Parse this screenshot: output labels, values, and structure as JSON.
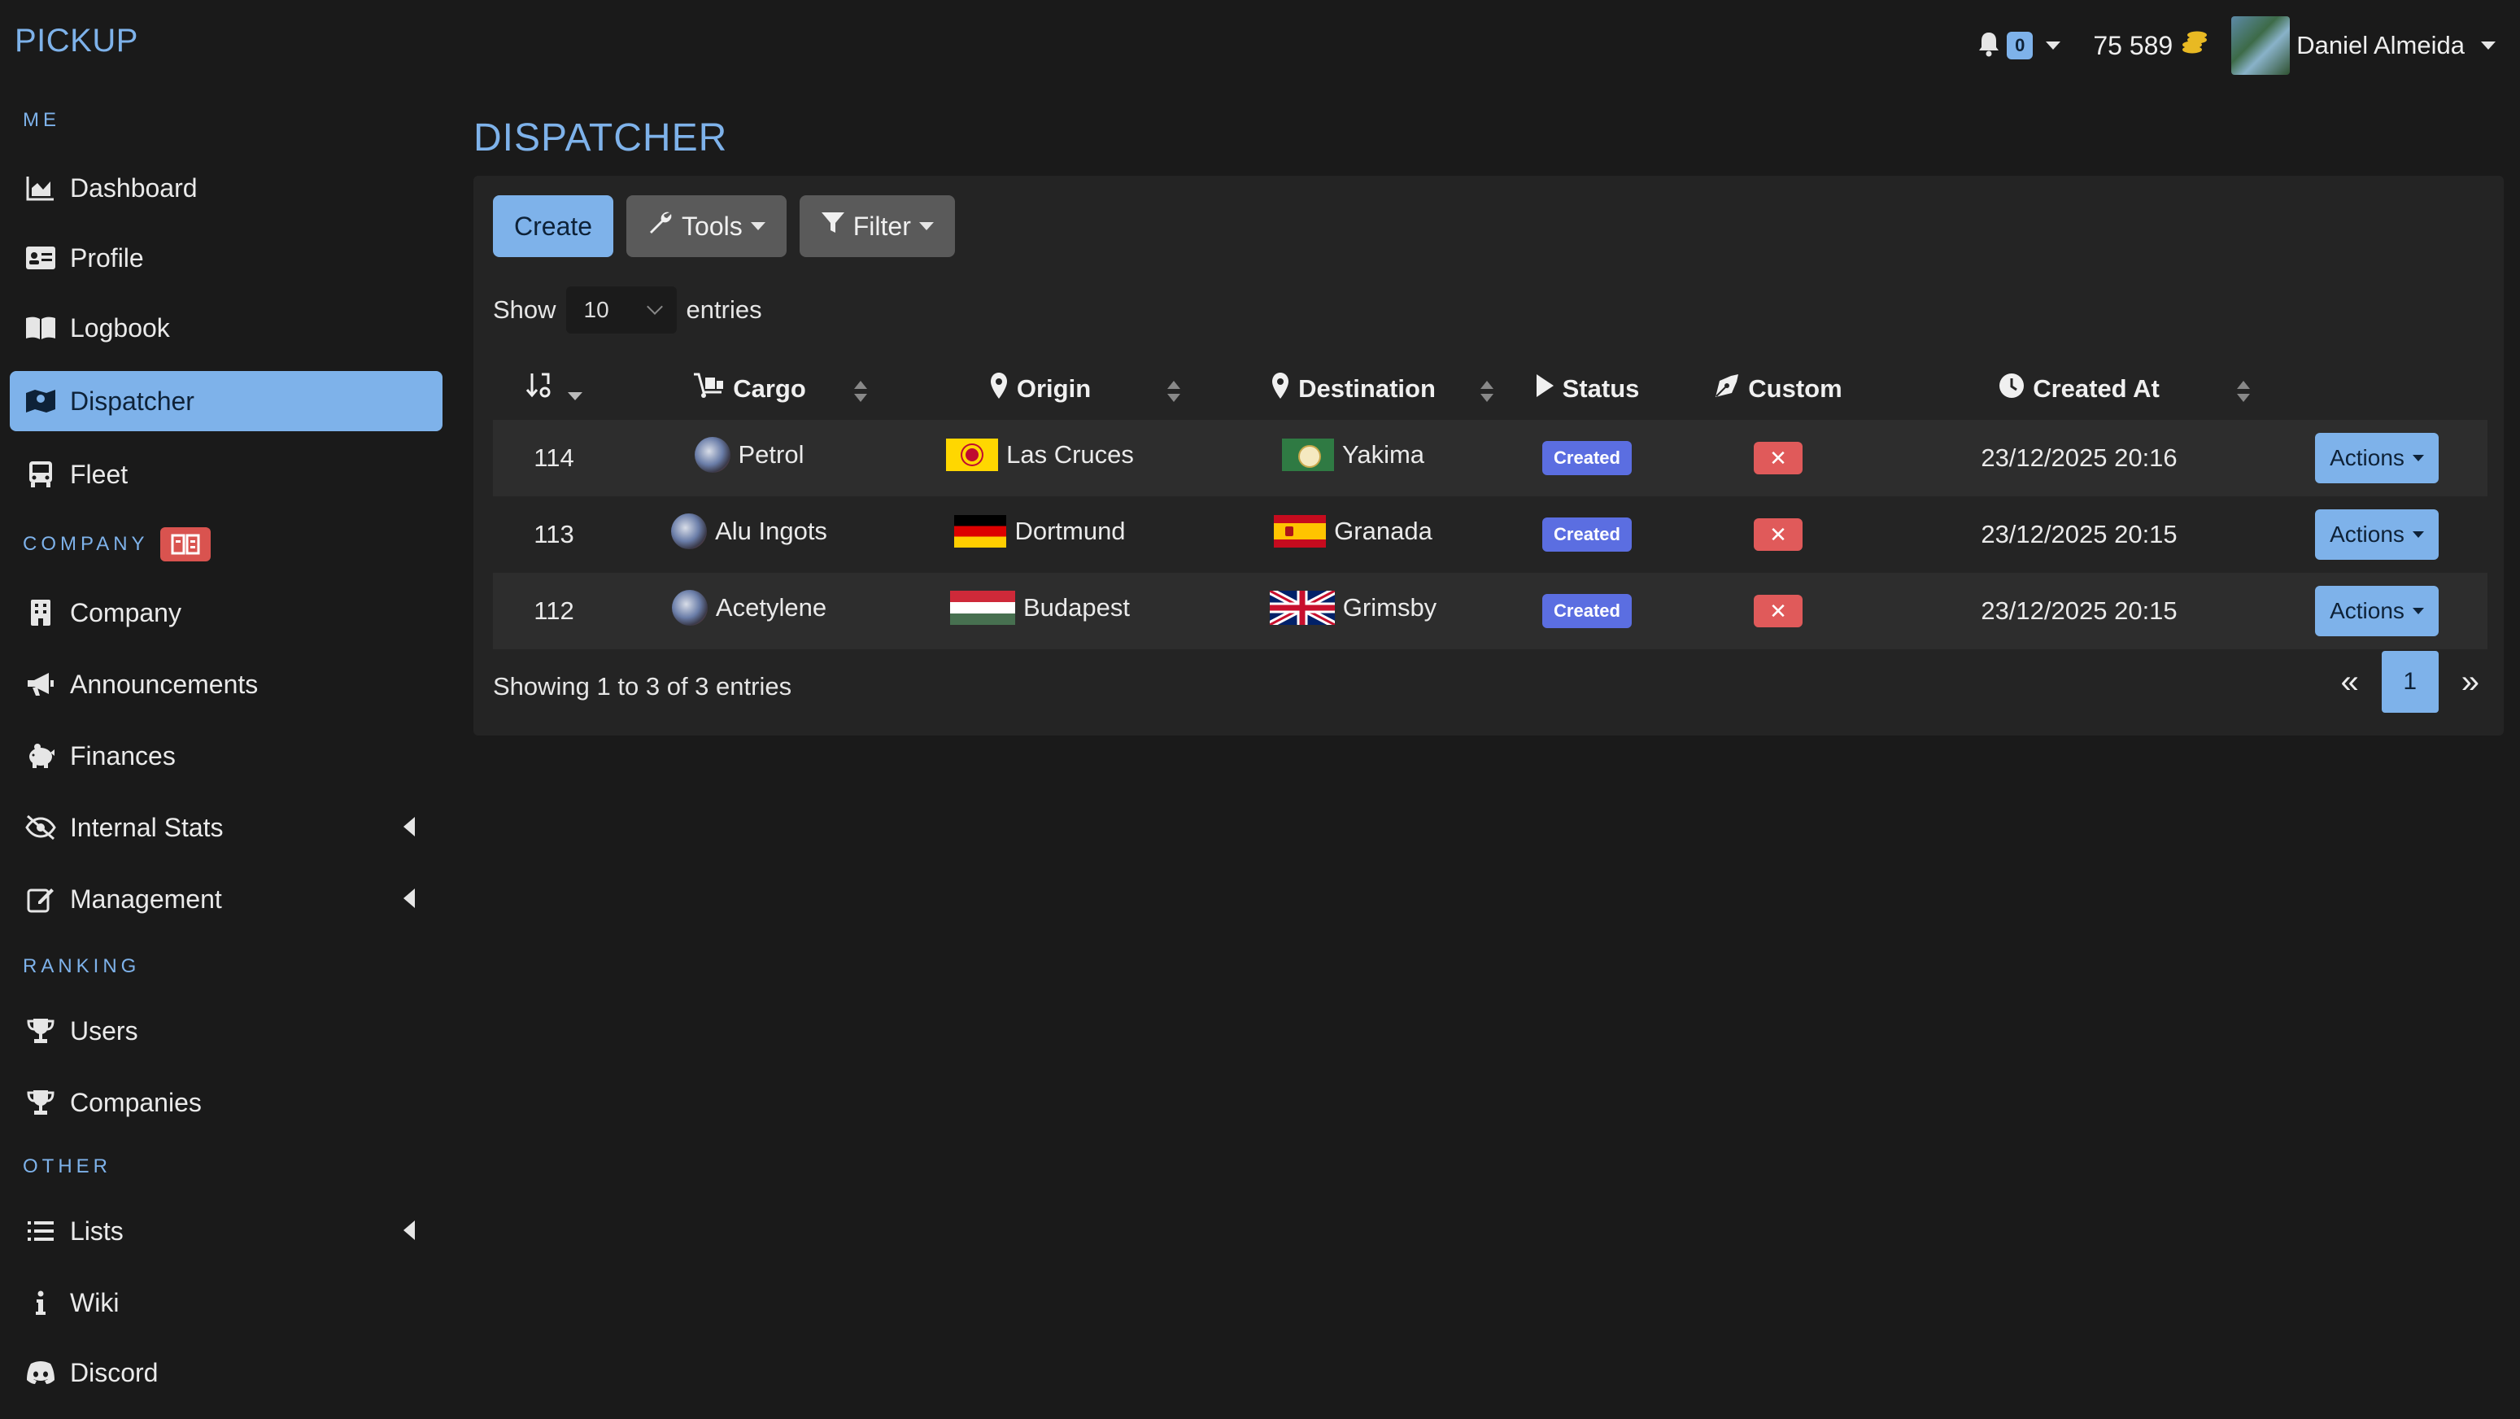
{
  "app": {
    "brand": "PICKUP"
  },
  "sidebar": {
    "sections": {
      "me": "ME",
      "company": "COMPANY",
      "ranking": "RANKING",
      "other": "OTHER"
    },
    "items": [
      {
        "label": "Dashboard",
        "icon": "chart-area-icon"
      },
      {
        "label": "Profile",
        "icon": "id-card-icon"
      },
      {
        "label": "Logbook",
        "icon": "book-open-icon"
      },
      {
        "label": "Dispatcher",
        "icon": "map-icon",
        "active": true
      },
      {
        "label": "Fleet",
        "icon": "truck-icon"
      },
      {
        "label": "Company",
        "icon": "building-icon"
      },
      {
        "label": "Announcements",
        "icon": "bullhorn-icon"
      },
      {
        "label": "Finances",
        "icon": "piggy-bank-icon"
      },
      {
        "label": "Internal Stats",
        "icon": "eye-slash-icon"
      },
      {
        "label": "Management",
        "icon": "edit-icon"
      },
      {
        "label": "Users",
        "icon": "trophy-icon"
      },
      {
        "label": "Companies",
        "icon": "trophy-icon"
      },
      {
        "label": "Lists",
        "icon": "list-icon"
      },
      {
        "label": "Wiki",
        "icon": "info-icon"
      },
      {
        "label": "Discord",
        "icon": "discord-icon"
      }
    ]
  },
  "topbar": {
    "notifications": "0",
    "balance": "75 589",
    "user_name": "Daniel Almeida"
  },
  "page": {
    "title": "DISPATCHER"
  },
  "toolbar": {
    "create": "Create",
    "tools": "Tools",
    "filter": "Filter"
  },
  "length": {
    "show": "Show",
    "value": "10",
    "entries": "entries"
  },
  "table": {
    "headers": {
      "cargo": "Cargo",
      "origin": "Origin",
      "destination": "Destination",
      "status": "Status",
      "custom": "Custom",
      "created_at": "Created At"
    },
    "rows": [
      {
        "id": "114",
        "cargo": "Petrol",
        "origin": "Las Cruces",
        "origin_flag": "new-mexico-flag",
        "destination": "Yakima",
        "destination_flag": "washington-flag",
        "status": "Created",
        "custom": "✕",
        "created_at": "23/12/2025 20:16",
        "actions": "Actions"
      },
      {
        "id": "113",
        "cargo": "Alu Ingots",
        "origin": "Dortmund",
        "origin_flag": "germany-flag",
        "destination": "Granada",
        "destination_flag": "spain-flag",
        "status": "Created",
        "custom": "✕",
        "created_at": "23/12/2025 20:15",
        "actions": "Actions"
      },
      {
        "id": "112",
        "cargo": "Acetylene",
        "origin": "Budapest",
        "origin_flag": "hungary-flag",
        "destination": "Grimsby",
        "destination_flag": "uk-flag",
        "status": "Created",
        "custom": "✕",
        "created_at": "23/12/2025 20:15",
        "actions": "Actions"
      }
    ]
  },
  "footer": {
    "info": "Showing 1 to 3 of 3 entries",
    "page": "1"
  },
  "colors": {
    "accent": "#7eb2ea",
    "danger": "#e05a5a",
    "status": "#5b6ee1"
  }
}
